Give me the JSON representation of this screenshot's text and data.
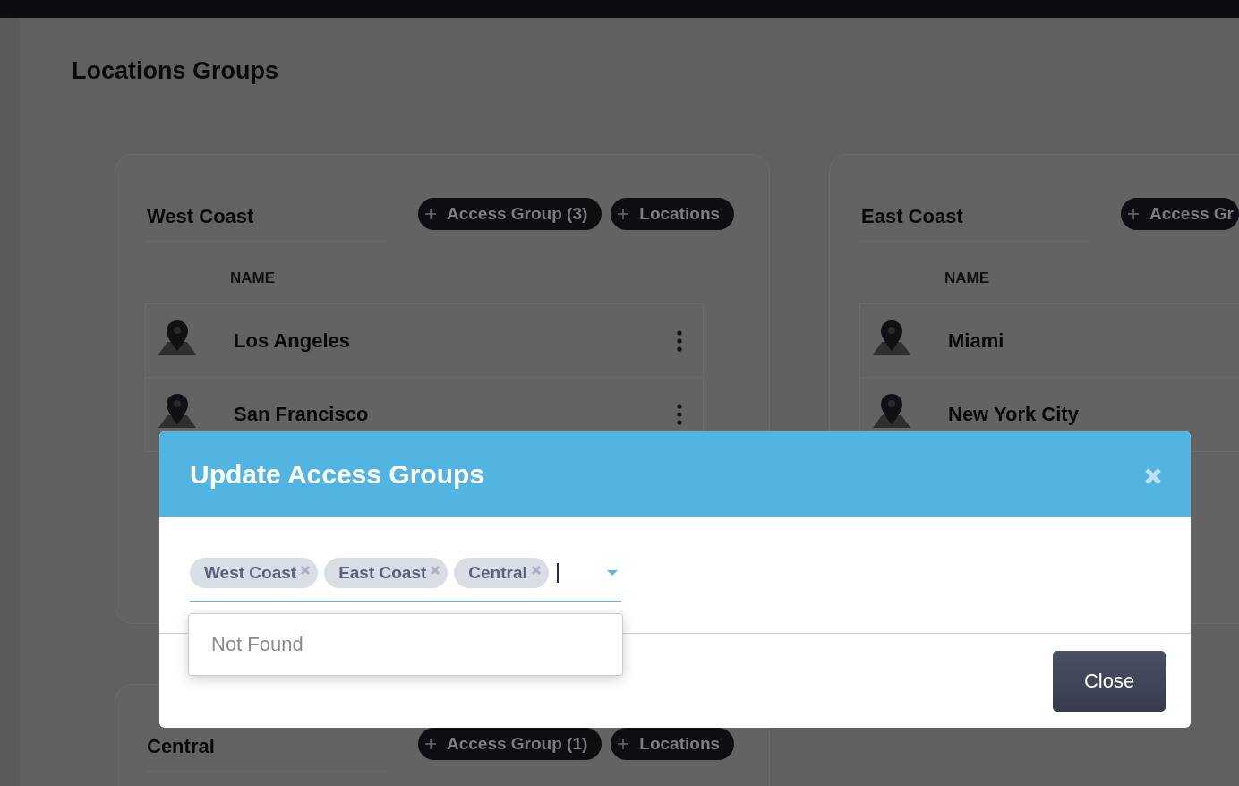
{
  "page": {
    "title": "Locations Groups"
  },
  "groups": [
    {
      "name": "West Coast",
      "buttons": [
        {
          "label": "Access Group (3)"
        },
        {
          "label": "Locations"
        }
      ],
      "column_header": "NAME",
      "locations": [
        {
          "name": "Los Angeles",
          "menu": true
        },
        {
          "name": "San Francisco",
          "menu": true
        }
      ]
    },
    {
      "name": "East Coast",
      "buttons": [
        {
          "label": "Access Gr"
        }
      ],
      "column_header": "NAME",
      "locations": [
        {
          "name": "Miami",
          "menu": false
        },
        {
          "name": "New York City",
          "menu": false
        }
      ]
    },
    {
      "name": "Central",
      "buttons": [
        {
          "label": "Access Group (1)"
        },
        {
          "label": "Locations"
        }
      ]
    }
  ],
  "modal": {
    "title": "Update Access Groups",
    "tags": [
      {
        "label": "West Coast"
      },
      {
        "label": "East Coast"
      },
      {
        "label": "Central"
      }
    ],
    "dropdown": {
      "message": "Not Found"
    },
    "buttons": [
      {
        "label": "Close"
      }
    ]
  }
}
